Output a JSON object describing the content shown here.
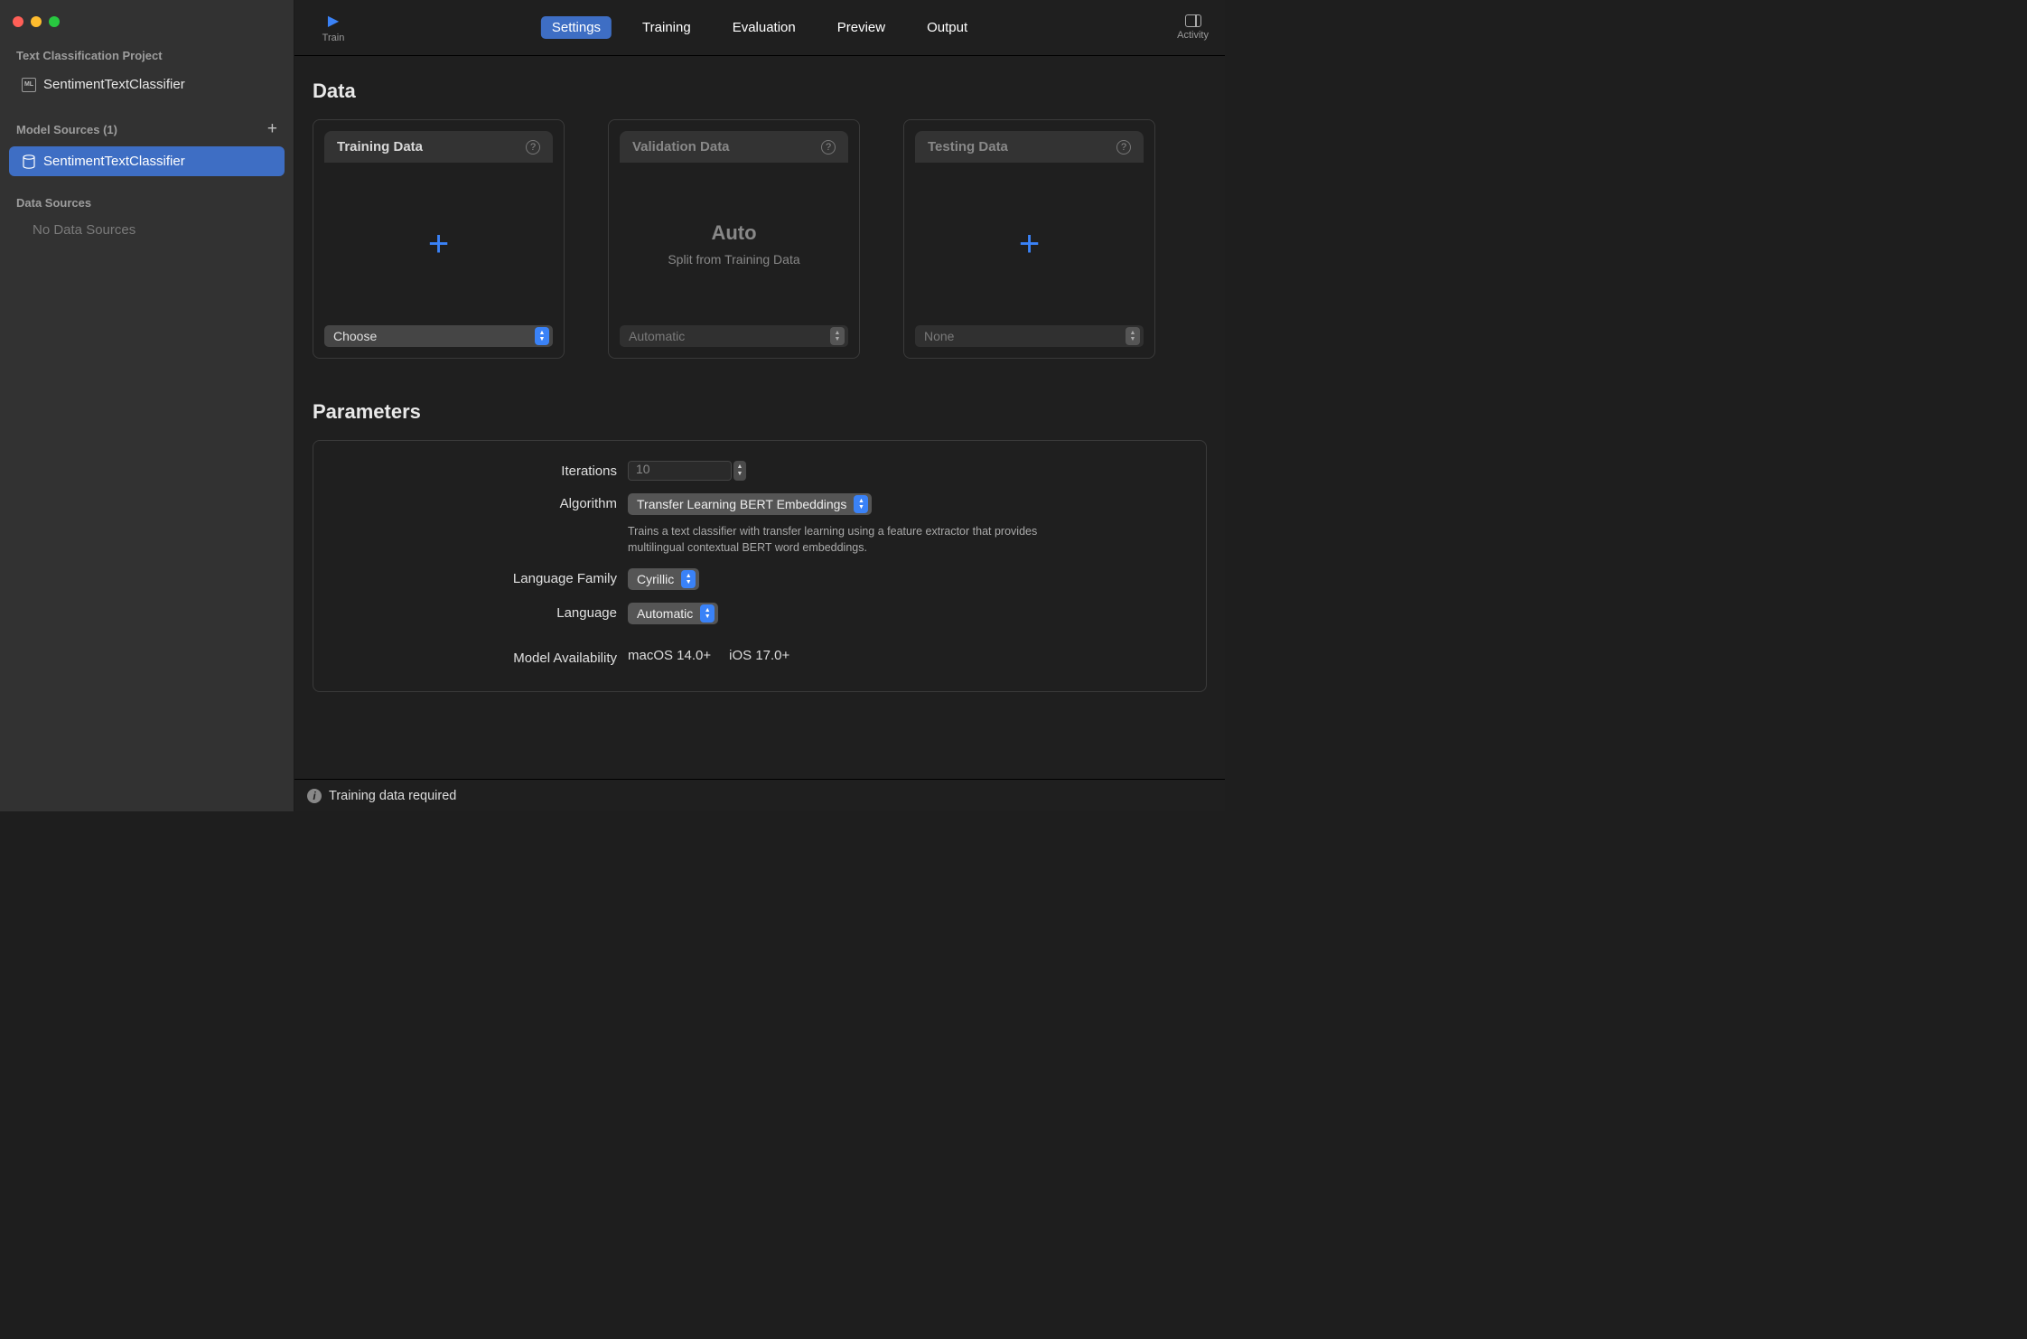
{
  "sidebar": {
    "project_header": "Text Classification Project",
    "project_item": "SentimentTextClassifier",
    "model_sources_header": "Model Sources (1)",
    "model_source_item": "SentimentTextClassifier",
    "data_sources_header": "Data Sources",
    "no_data_sources": "No Data Sources"
  },
  "toolbar": {
    "train_label": "Train",
    "tabs": {
      "settings": "Settings",
      "training": "Training",
      "evaluation": "Evaluation",
      "preview": "Preview",
      "output": "Output"
    },
    "activity_label": "Activity"
  },
  "sections": {
    "data": "Data",
    "parameters": "Parameters"
  },
  "data_cards": {
    "training": {
      "title": "Training Data",
      "select": "Choose"
    },
    "validation": {
      "title": "Validation Data",
      "auto": "Auto",
      "sub": "Split from Training Data",
      "select": "Automatic"
    },
    "testing": {
      "title": "Testing Data",
      "select": "None"
    }
  },
  "params": {
    "iterations_label": "Iterations",
    "iterations_value": "10",
    "algorithm_label": "Algorithm",
    "algorithm_value": "Transfer Learning BERT Embeddings",
    "algorithm_desc": "Trains a text classifier with transfer learning using a feature extractor that provides multilingual contextual BERT word embeddings.",
    "language_family_label": "Language Family",
    "language_family_value": "Cyrillic",
    "language_label": "Language",
    "language_value": "Automatic",
    "availability_label": "Model Availability",
    "availability_macos": "macOS 14.0+",
    "availability_ios": "iOS 17.0+"
  },
  "status": {
    "message": "Training data required"
  }
}
